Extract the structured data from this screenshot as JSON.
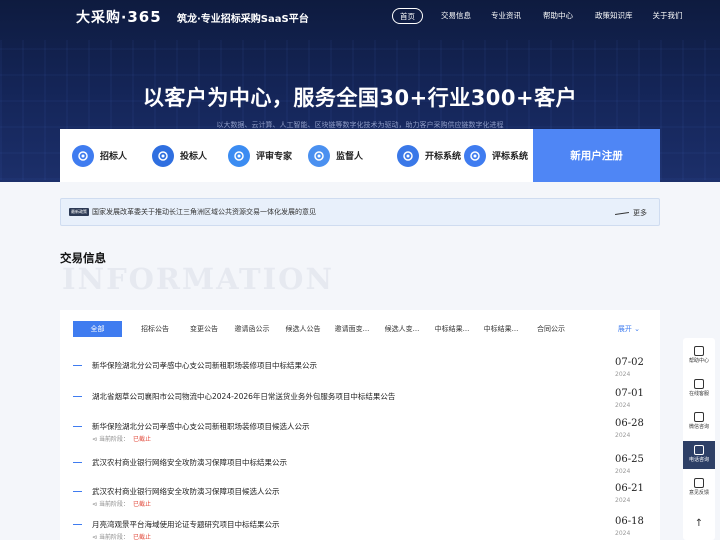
{
  "nav": {
    "logo_text": "大采购·",
    "logo_num": "365",
    "slogan": "筑龙·专业招标采购SaaS平台",
    "menu": [
      "首页",
      "交易信息",
      "专业资讯",
      "帮助中心",
      "政策知识库",
      "关于我们"
    ],
    "active_index": 0
  },
  "hero": {
    "headline": "以客户为中心，服务全国30+行业300+客户",
    "subline": "以大数据、云计算、人工智能、区块链等数字化技术为驱动，助力客户采购供应链数字化进程"
  },
  "roles": [
    {
      "label": "招标人",
      "color": "#3f7cf0"
    },
    {
      "label": "投标人",
      "color": "#2f6fe0"
    },
    {
      "label": "评审专家",
      "color": "#3b8cf2"
    },
    {
      "label": "监督人",
      "color": "#4a90f0"
    },
    {
      "label": "开标系统",
      "color": "#3a78e8"
    },
    {
      "label": "评标系统",
      "color": "#3f7cf0"
    }
  ],
  "register_label": "新用户注册",
  "notice": {
    "tag": "最新政策",
    "text": "国家发展改革委关于推动长江三角洲区域公共资源交易一体化发展的意见",
    "more": "更多"
  },
  "section": {
    "title": "交易信息",
    "watermark": "INFORMATION"
  },
  "tabs": [
    "全部",
    "招标公告",
    "变更公告",
    "邀请函公示",
    "候选人公告",
    "邀请面变...",
    "候选人变...",
    "中标结果...",
    "中标结果...",
    "合同公示"
  ],
  "expand_label": "展开",
  "stage_label": "当前阶段：",
  "listings": [
    {
      "title": "新华保险湖北分公司孝感中心支公司新租职场装修项目中标结果公示",
      "stage": "",
      "day": "07-02",
      "year": "2024"
    },
    {
      "title": "湖北省烟草公司襄阳市公司物流中心2024-2026年日常送货业务外包服务项目中标结果公告",
      "stage": "",
      "day": "07-01",
      "year": "2024"
    },
    {
      "title": "新华保险湖北分公司孝感中心支公司新租职场装修项目候选人公示",
      "stage": "已截止",
      "day": "06-28",
      "year": "2024"
    },
    {
      "title": "武汉农村商业银行网络安全攻防演习保障项目中标结果公示",
      "stage": "",
      "day": "06-25",
      "year": "2024"
    },
    {
      "title": "武汉农村商业银行网络安全攻防演习保障项目候选人公示",
      "stage": "已截止",
      "day": "06-21",
      "year": "2024"
    },
    {
      "title": "月亮湾观景平台海域使用论证专题研究项目中标结果公示",
      "stage": "已截止",
      "day": "06-18",
      "year": "2024"
    }
  ],
  "sidebar": [
    "帮助中心",
    "在线客服",
    "微信咨询",
    "电话咨询",
    "意见反馈"
  ],
  "sidebar_active": 3
}
